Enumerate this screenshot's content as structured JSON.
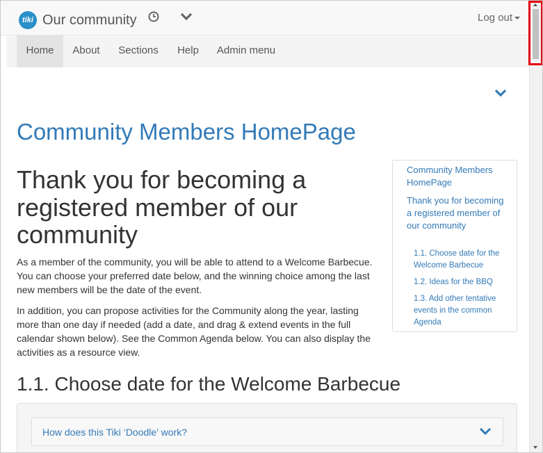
{
  "navbar": {
    "logo_text": "tiki",
    "site_name": "Our community",
    "recent_icon": "clock-icon",
    "menu_icon": "chevron-down-icon",
    "logout_label": "Log out"
  },
  "menu": {
    "items": [
      {
        "label": "Home",
        "active": true
      },
      {
        "label": "About",
        "active": false
      },
      {
        "label": "Sections",
        "active": false
      },
      {
        "label": "Help",
        "active": false
      },
      {
        "label": "Admin menu",
        "active": false
      }
    ]
  },
  "page": {
    "title": "Community Members HomePage",
    "heading": "Thank you for becoming a registered member of our community",
    "paragraph1": "As a member of the community, you will be able to attend to a Welcome Barbecue. You can choose your preferred date below, and the winning choice among the last new members will be the date of the event.",
    "paragraph2": "In addition, you can propose activities for the Community along the year, lasting more than one day if needed (add a date, and drag & extend events in the full calendar shown below). See the Common Agenda below. You can also display the activities as a resource view.",
    "section_heading": "1.1. Choose date for the Welcome Barbecue"
  },
  "toc": {
    "items": [
      {
        "label": "Community Members HomePage",
        "level": 1
      },
      {
        "label": "Thank you for becoming a registered member of our community",
        "level": 1
      },
      {
        "label": "1.1. Choose date for the Welcome Barbecue",
        "level": 2
      },
      {
        "label": "1.2. Ideas for the BBQ",
        "level": 2
      },
      {
        "label": "1.3. Add other tentative events in the common Agenda",
        "level": 2
      }
    ]
  },
  "accordion": {
    "label": "How does this Tiki ‘Doodle’ work?",
    "icon": "chevron-down-icon"
  },
  "colors": {
    "link": "#337ab7",
    "navbar_bg": "#f8f8f8",
    "active_tab_bg": "#e3e3e3",
    "highlight": "#e3000f"
  }
}
